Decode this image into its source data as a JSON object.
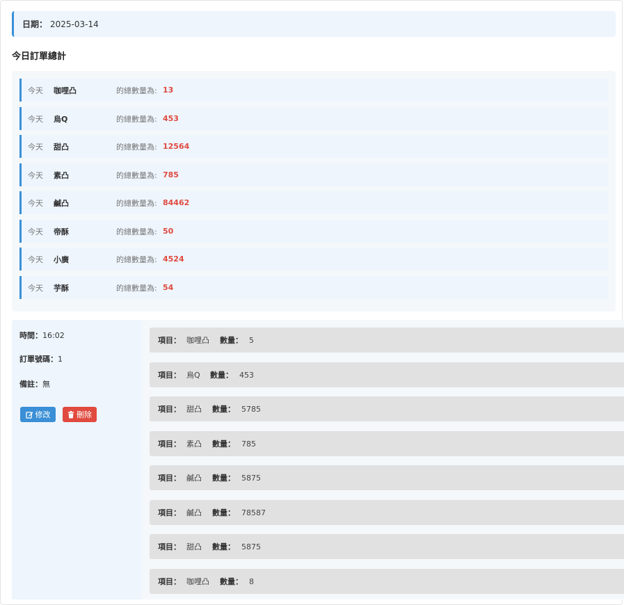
{
  "date": {
    "label": "日期：",
    "value": "2025-03-14"
  },
  "summary": {
    "title": "今日訂單總計",
    "prefix": "今天",
    "phrase": "的總數量為:",
    "rows": [
      {
        "item": "咖哩凸",
        "count": "13"
      },
      {
        "item": "烏Q",
        "count": "453"
      },
      {
        "item": "甜凸",
        "count": "12564"
      },
      {
        "item": "素凸",
        "count": "785"
      },
      {
        "item": "鹹凸",
        "count": "84462"
      },
      {
        "item": "帝酥",
        "count": "50"
      },
      {
        "item": "小廣",
        "count": "4524"
      },
      {
        "item": "芋酥",
        "count": "54"
      }
    ]
  },
  "order": {
    "time_label": "時間：",
    "time": "16:02",
    "number_label": "訂單號碼：",
    "number": "1",
    "note_label": "備註：",
    "note": "無",
    "edit_label": "修改",
    "delete_label": "刪除",
    "edit_icon": "edit-icon",
    "delete_icon": "trash-icon",
    "item_label": "項目：",
    "qty_label": "數量：",
    "lines": [
      {
        "item": "咖哩凸",
        "qty": "5"
      },
      {
        "item": "烏Q",
        "qty": "453"
      },
      {
        "item": "甜凸",
        "qty": "5785"
      },
      {
        "item": "素凸",
        "qty": "785"
      },
      {
        "item": "鹹凸",
        "qty": "5875"
      },
      {
        "item": "鹹凸",
        "qty": "78587"
      },
      {
        "item": "甜凸",
        "qty": "5875"
      },
      {
        "item": "咖哩凸",
        "qty": "8"
      }
    ]
  },
  "colors": {
    "accent": "#3a8fd6",
    "danger": "#e04a3f",
    "count": "#e04a3f"
  }
}
